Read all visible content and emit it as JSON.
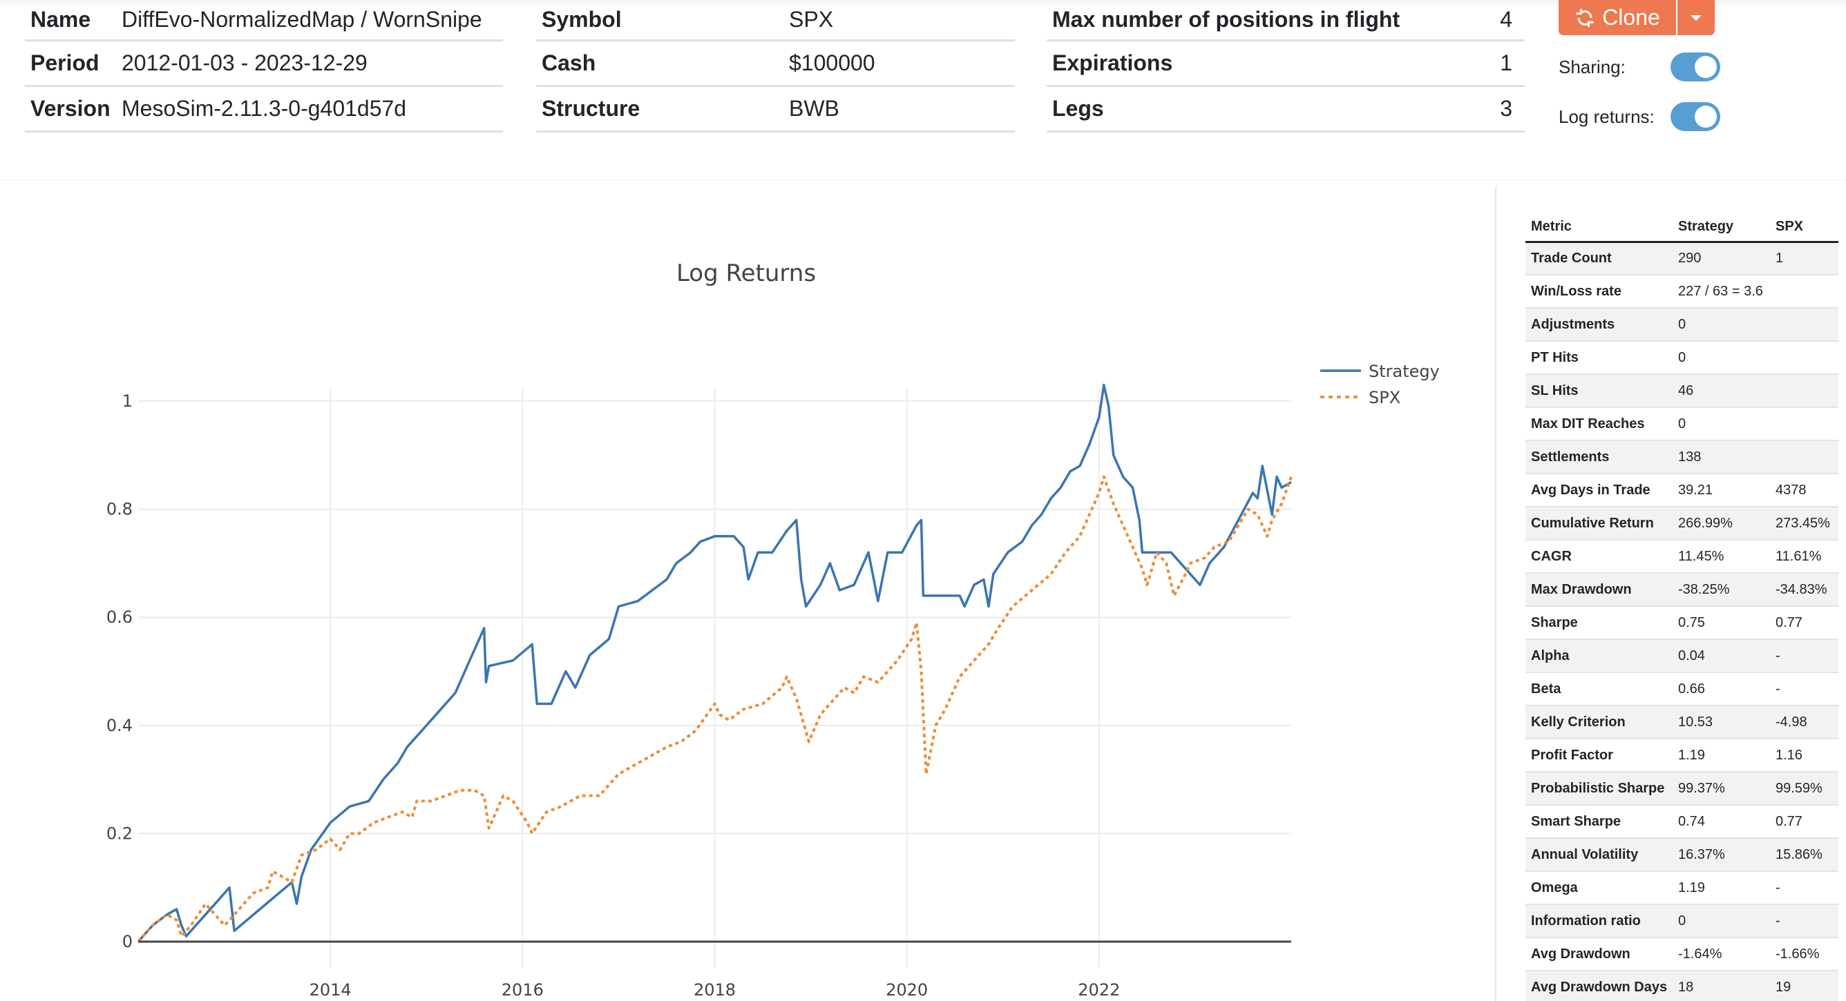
{
  "summary": {
    "col1": [
      {
        "key": "Name",
        "value": "DiffEvo-NormalizedMap / WornSnipe"
      },
      {
        "key": "Period",
        "value": "2012-01-03 - 2023-12-29"
      },
      {
        "key": "Version",
        "value": "MesoSim-2.11.3-0-g401d57d"
      }
    ],
    "col2": [
      {
        "key": "Symbol",
        "value": "SPX"
      },
      {
        "key": "Cash",
        "value": "$100000"
      },
      {
        "key": "Structure",
        "value": "BWB"
      }
    ],
    "col3": [
      {
        "key": "Max number of positions in flight",
        "value": "4"
      },
      {
        "key": "Expirations",
        "value": "1"
      },
      {
        "key": "Legs",
        "value": "3"
      }
    ]
  },
  "actions": {
    "clone_label": "Clone",
    "clone_icon": "refresh-icon",
    "dropdown_icon": "caret-down-icon",
    "sharing_label": "Sharing:",
    "sharing_on": true,
    "log_returns_label": "Log returns:",
    "log_returns_on": true,
    "accent_color": "#ee7950",
    "toggle_color": "#579fd3"
  },
  "metrics": {
    "headers": [
      "Metric",
      "Strategy",
      "SPX"
    ],
    "rows": [
      [
        "Trade Count",
        "290",
        "1"
      ],
      [
        "Win/Loss rate",
        "227 / 63 = 3.6",
        ""
      ],
      [
        "Adjustments",
        "0",
        ""
      ],
      [
        "PT Hits",
        "0",
        ""
      ],
      [
        "SL Hits",
        "46",
        ""
      ],
      [
        "Max DIT Reaches",
        "0",
        ""
      ],
      [
        "Settlements",
        "138",
        ""
      ],
      [
        "Avg Days in Trade",
        "39.21",
        "4378"
      ],
      [
        "Cumulative Return",
        "266.99%",
        "273.45%"
      ],
      [
        "CAGR",
        "11.45%",
        "11.61%"
      ],
      [
        "Max Drawdown",
        "-38.25%",
        "-34.83%"
      ],
      [
        "Sharpe",
        "0.75",
        "0.77"
      ],
      [
        "Alpha",
        "0.04",
        "-"
      ],
      [
        "Beta",
        "0.66",
        "-"
      ],
      [
        "Kelly Criterion",
        "10.53",
        "-4.98"
      ],
      [
        "Profit Factor",
        "1.19",
        "1.16"
      ],
      [
        "Probabilistic Sharpe",
        "99.37%",
        "99.59%"
      ],
      [
        "Smart Sharpe",
        "0.74",
        "0.77"
      ],
      [
        "Annual Volatility",
        "16.37%",
        "15.86%"
      ],
      [
        "Omega",
        "1.19",
        "-"
      ],
      [
        "Information ratio",
        "0",
        "-"
      ],
      [
        "Avg Drawdown",
        "-1.64%",
        "-1.66%"
      ],
      [
        "Avg Drawdown Days",
        "18",
        "19"
      ]
    ]
  },
  "chart_data": {
    "type": "line",
    "title": "Log Returns",
    "xlabel": "",
    "ylabel": "",
    "xlim": [
      2012.0,
      2024.0
    ],
    "ylim": [
      0,
      1.1
    ],
    "x_ticks": [
      2014,
      2016,
      2018,
      2020,
      2022
    ],
    "x_tick_labels": [
      "2014",
      "2016",
      "2018",
      "2020",
      "2022"
    ],
    "y_ticks": [
      0,
      0.2,
      0.4,
      0.6,
      0.8,
      1
    ],
    "y_tick_labels": [
      "0",
      "0.2",
      "0.4",
      "0.6",
      "0.8",
      "1"
    ],
    "grid": true,
    "legend_position": "top-right",
    "series": [
      {
        "name": "Strategy",
        "color": "#3a75b0",
        "style": "solid",
        "x": [
          2012.0,
          2012.15,
          2012.3,
          2012.4,
          2012.45,
          2012.5,
          2012.65,
          2012.8,
          2012.95,
          2013.0,
          2013.2,
          2013.4,
          2013.6,
          2013.65,
          2013.7,
          2013.8,
          2014.0,
          2014.2,
          2014.4,
          2014.55,
          2014.7,
          2014.8,
          2015.0,
          2015.15,
          2015.3,
          2015.45,
          2015.6,
          2015.62,
          2015.65,
          2015.9,
          2016.1,
          2016.15,
          2016.3,
          2016.45,
          2016.55,
          2016.7,
          2016.9,
          2017.0,
          2017.2,
          2017.35,
          2017.5,
          2017.6,
          2017.75,
          2017.85,
          2018.0,
          2018.2,
          2018.3,
          2018.35,
          2018.45,
          2018.6,
          2018.75,
          2018.85,
          2018.9,
          2018.95,
          2019.1,
          2019.2,
          2019.3,
          2019.45,
          2019.6,
          2019.7,
          2019.8,
          2019.95,
          2020.1,
          2020.15,
          2020.17,
          2020.55,
          2020.6,
          2020.7,
          2020.8,
          2020.85,
          2020.9,
          2021.05,
          2021.2,
          2021.3,
          2021.4,
          2021.5,
          2021.6,
          2021.7,
          2021.8,
          2021.9,
          2022.0,
          2022.05,
          2022.1,
          2022.15,
          2022.25,
          2022.35,
          2022.42,
          2022.45,
          2022.65,
          2022.75,
          2022.85,
          2022.95,
          2023.05,
          2023.15,
          2023.3,
          2023.45,
          2023.6,
          2023.65,
          2023.7,
          2023.8,
          2023.85,
          2023.9,
          2024.0
        ],
        "values": [
          0.0,
          0.03,
          0.05,
          0.06,
          0.03,
          0.01,
          0.04,
          0.07,
          0.1,
          0.02,
          0.05,
          0.08,
          0.11,
          0.07,
          0.12,
          0.17,
          0.22,
          0.25,
          0.26,
          0.3,
          0.33,
          0.36,
          0.4,
          0.43,
          0.46,
          0.52,
          0.58,
          0.48,
          0.51,
          0.52,
          0.55,
          0.44,
          0.44,
          0.5,
          0.47,
          0.53,
          0.56,
          0.62,
          0.63,
          0.65,
          0.67,
          0.7,
          0.72,
          0.74,
          0.75,
          0.75,
          0.73,
          0.67,
          0.72,
          0.72,
          0.76,
          0.78,
          0.67,
          0.62,
          0.66,
          0.7,
          0.65,
          0.66,
          0.72,
          0.63,
          0.72,
          0.72,
          0.77,
          0.78,
          0.64,
          0.64,
          0.62,
          0.66,
          0.67,
          0.62,
          0.68,
          0.72,
          0.74,
          0.77,
          0.79,
          0.82,
          0.84,
          0.87,
          0.88,
          0.92,
          0.97,
          1.03,
          0.99,
          0.9,
          0.86,
          0.84,
          0.78,
          0.72,
          0.72,
          0.72,
          0.7,
          0.68,
          0.66,
          0.7,
          0.73,
          0.78,
          0.83,
          0.82,
          0.88,
          0.79,
          0.86,
          0.84,
          0.85
        ]
      },
      {
        "name": "SPX",
        "color": "#ef8c35",
        "style": "dotted",
        "x": [
          2012.0,
          2012.15,
          2012.3,
          2012.4,
          2012.45,
          2012.55,
          2012.7,
          2012.8,
          2012.9,
          2013.05,
          2013.2,
          2013.35,
          2013.4,
          2013.5,
          2013.6,
          2013.7,
          2013.85,
          2014.0,
          2014.1,
          2014.2,
          2014.3,
          2014.45,
          2014.6,
          2014.75,
          2014.85,
          2014.9,
          2015.05,
          2015.2,
          2015.35,
          2015.5,
          2015.6,
          2015.65,
          2015.8,
          2015.9,
          2016.05,
          2016.1,
          2016.25,
          2016.4,
          2016.6,
          2016.8,
          2016.9,
          2017.0,
          2017.2,
          2017.5,
          2017.65,
          2017.8,
          2018.0,
          2018.05,
          2018.15,
          2018.3,
          2018.5,
          2018.7,
          2018.75,
          2018.85,
          2018.98,
          2019.1,
          2019.2,
          2019.35,
          2019.45,
          2019.55,
          2019.7,
          2019.9,
          2020.05,
          2020.1,
          2020.15,
          2020.2,
          2020.3,
          2020.4,
          2020.55,
          2020.7,
          2020.85,
          2020.95,
          2021.1,
          2021.3,
          2021.5,
          2021.65,
          2021.8,
          2021.9,
          2022.0,
          2022.05,
          2022.15,
          2022.3,
          2022.45,
          2022.5,
          2022.6,
          2022.7,
          2022.78,
          2022.9,
          2022.95,
          2023.1,
          2023.2,
          2023.35,
          2023.55,
          2023.65,
          2023.75,
          2023.8,
          2023.9,
          2024.0
        ],
        "values": [
          0.0,
          0.03,
          0.05,
          0.04,
          0.01,
          0.03,
          0.07,
          0.05,
          0.03,
          0.06,
          0.09,
          0.1,
          0.13,
          0.12,
          0.11,
          0.16,
          0.17,
          0.19,
          0.17,
          0.2,
          0.2,
          0.22,
          0.23,
          0.24,
          0.23,
          0.26,
          0.26,
          0.27,
          0.28,
          0.28,
          0.27,
          0.21,
          0.27,
          0.26,
          0.22,
          0.2,
          0.24,
          0.25,
          0.27,
          0.27,
          0.29,
          0.31,
          0.33,
          0.36,
          0.37,
          0.39,
          0.44,
          0.42,
          0.41,
          0.43,
          0.44,
          0.47,
          0.49,
          0.45,
          0.37,
          0.42,
          0.44,
          0.47,
          0.46,
          0.49,
          0.48,
          0.52,
          0.56,
          0.59,
          0.5,
          0.31,
          0.4,
          0.43,
          0.49,
          0.52,
          0.55,
          0.58,
          0.62,
          0.65,
          0.68,
          0.72,
          0.75,
          0.79,
          0.83,
          0.86,
          0.81,
          0.75,
          0.69,
          0.66,
          0.72,
          0.7,
          0.64,
          0.68,
          0.7,
          0.71,
          0.73,
          0.74,
          0.8,
          0.79,
          0.75,
          0.78,
          0.81,
          0.86
        ]
      }
    ]
  }
}
